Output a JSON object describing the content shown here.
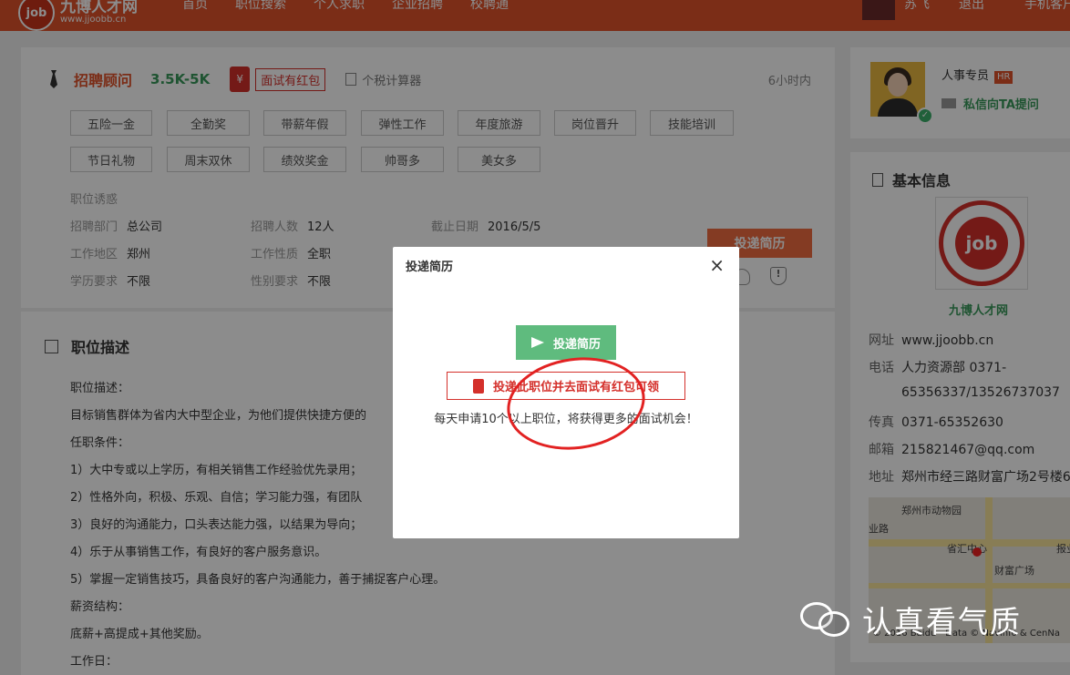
{
  "header": {
    "logo_mark": "job",
    "logo_title": "九博人才网",
    "logo_url": "www.jjoobb.cn",
    "nav": [
      "首页",
      "职位搜索",
      "个人求职",
      "企业招聘",
      "校聘通"
    ],
    "user_name": "苏飞",
    "logout": "退出",
    "mobile": "手机客户"
  },
  "job": {
    "title": "招聘顾问",
    "salary": "3.5K-5K",
    "redpack_symbol": "¥",
    "redpack_tag": "面试有红包",
    "calculator": "个税计算器",
    "posted": "6小时内",
    "benefits": [
      "五险一金",
      "全勤奖",
      "带薪年假",
      "弹性工作",
      "年度旅游",
      "岗位晋升",
      "技能培训",
      "节日礼物",
      "周末双休",
      "绩效奖金",
      "帅哥多",
      "美女多"
    ],
    "section_label": "职位诱惑",
    "fields": [
      {
        "k": "招聘部门",
        "v": "总公司"
      },
      {
        "k": "招聘人数",
        "v": "12人"
      },
      {
        "k": "截止日期",
        "v": "2016/5/5"
      },
      {
        "k": "工作地区",
        "v": "郑州"
      },
      {
        "k": "工作性质",
        "v": "全职"
      },
      {
        "k": "学历要求",
        "v": "不限"
      },
      {
        "k": "性别要求",
        "v": "不限"
      }
    ],
    "apply_label": "投递简历",
    "shield_mark": "!"
  },
  "description": {
    "heading": "职位描述",
    "lines": [
      "职位描述：",
      "目标销售群体为省内大中型企业，为他们提供快捷方便的",
      "任职条件：",
      "1）大中专或以上学历，有相关销售工作经验优先录用；",
      "2）性格外向，积极、乐观、自信；学习能力强，有团队",
      "3）良好的沟通能力，口头表达能力强，以结果为导向；",
      "4）乐于从事销售工作，有良好的客户服务意识。",
      "5）掌握一定销售技巧，具备良好的客户沟通能力，善于捕捉客户心理。",
      "薪资结构：",
      "底薪+高提成+其他奖励。",
      "工作日："
    ]
  },
  "hr": {
    "role": "人事专员",
    "badge": "HR",
    "verified_mark": "✓",
    "message": "私信向TA提问"
  },
  "company": {
    "heading": "基本信息",
    "logo_text": "job",
    "name": "九博人才网",
    "rows": [
      {
        "k": "网址",
        "v": "www.jjoobb.cn"
      },
      {
        "k": "电话",
        "v": "人力资源部 0371-"
      },
      {
        "k": "",
        "v": "65356337/13526737037"
      },
      {
        "k": "传真",
        "v": "0371-65352630"
      },
      {
        "k": "邮箱",
        "v": "215821467@qq.com"
      },
      {
        "k": "地址",
        "v": "郑州市经三路财富广场2号楼6"
      }
    ],
    "map_labels": [
      "郑州市动物园",
      "业路",
      "省汇中心",
      "财富广场",
      "报业"
    ],
    "map_copyright": "© 2016 Baidu - Data © Navinfo & CenNa"
  },
  "modal": {
    "title": "投递简历",
    "close": "×",
    "apply_label": "投递简历",
    "redpack_label": "投递此职位并去面试有红包可领",
    "note": "每天申请10个以上职位，将获得更多的面试机会！"
  },
  "watermark": {
    "text": "认真看气质"
  },
  "colors": {
    "brand": "#e0532b",
    "green": "#5fbb7e",
    "red": "#d4302b"
  }
}
